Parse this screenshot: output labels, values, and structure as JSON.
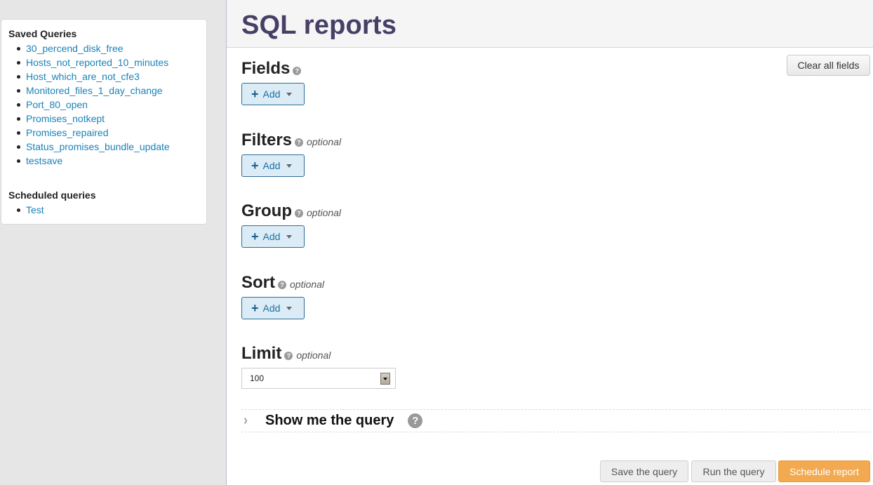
{
  "sidebar": {
    "saved_heading": "Saved Queries",
    "saved_queries": [
      "30_percend_disk_free",
      "Hosts_not_reported_10_minutes",
      "Host_which_are_not_cfe3",
      "Monitored_files_1_day_change",
      "Port_80_open",
      "Promises_notkept",
      "Promises_repaired",
      "Status_promises_bundle_update",
      "testsave"
    ],
    "scheduled_heading": "Scheduled queries",
    "scheduled_queries": [
      "Test"
    ]
  },
  "header": {
    "title": "SQL reports"
  },
  "toolbar": {
    "clear_label": "Clear all fields"
  },
  "sections": {
    "fields": {
      "title": "Fields",
      "optional": "",
      "add_label": "Add",
      "help_icon": "?"
    },
    "filters": {
      "title": "Filters",
      "optional": "optional",
      "add_label": "Add",
      "help_icon": "?"
    },
    "group": {
      "title": "Group",
      "optional": "optional",
      "add_label": "Add",
      "help_icon": "?"
    },
    "sort": {
      "title": "Sort",
      "optional": "optional",
      "add_label": "Add",
      "help_icon": "?"
    },
    "limit": {
      "title": "Limit",
      "optional": "optional",
      "value": "100",
      "help_icon": "?"
    }
  },
  "query_toggle": {
    "label": "Show me the query",
    "chevron_icon": "›",
    "help_icon": "?"
  },
  "actions": {
    "save_label": "Save the query",
    "run_label": "Run the query",
    "schedule_label": "Schedule report"
  },
  "colors": {
    "title": "#483f66",
    "link": "#1a82b8",
    "add_button_bg": "#dcecf6",
    "schedule_button": "#f3a94f"
  }
}
